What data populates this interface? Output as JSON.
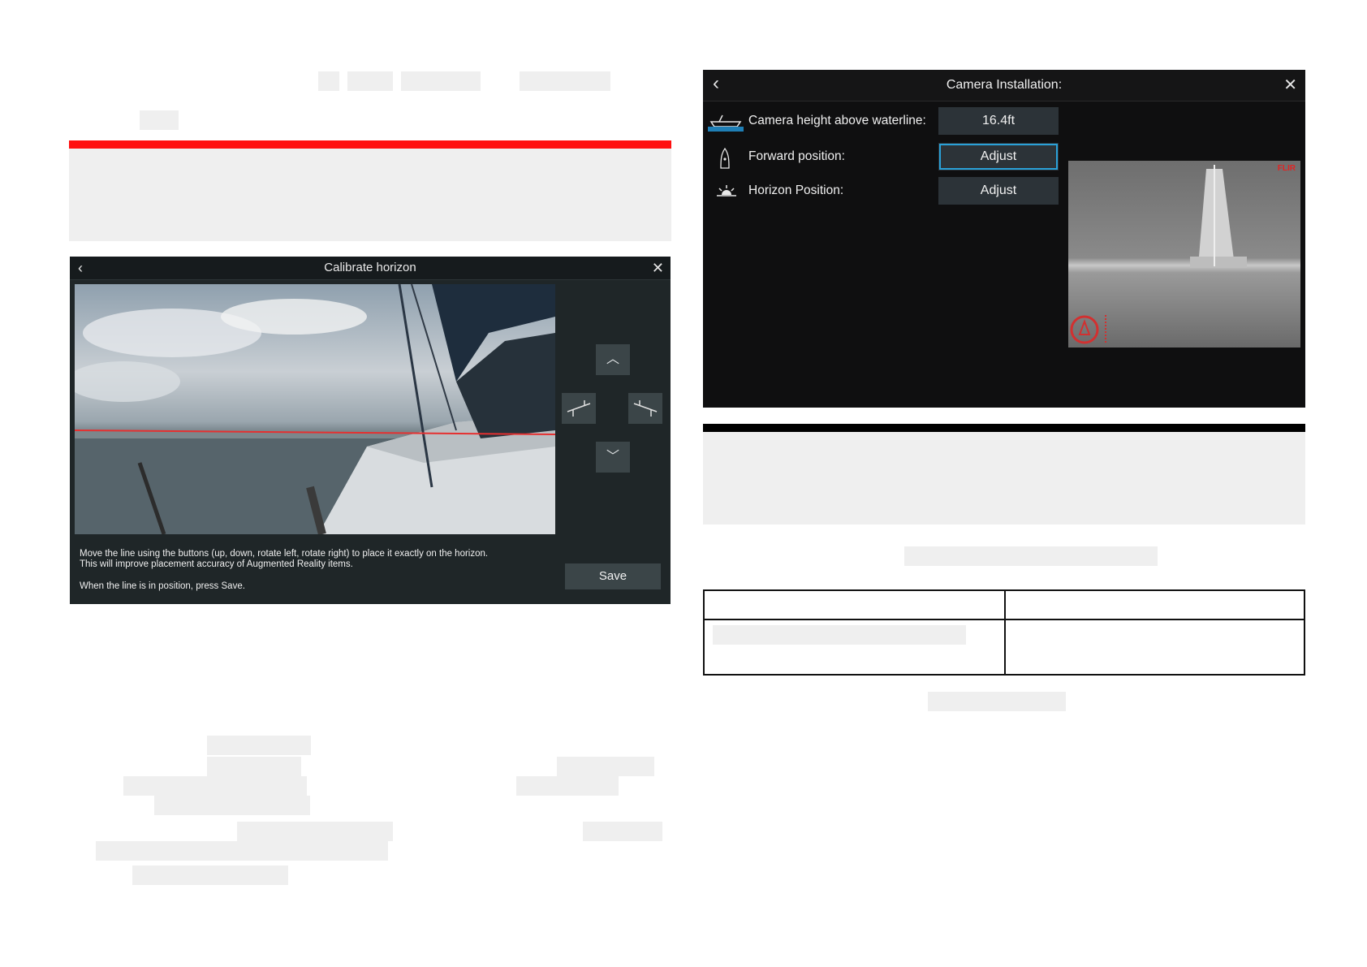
{
  "calibrate_panel": {
    "title": "Calibrate horizon",
    "controls": [
      "up",
      "rotate-left",
      "rotate-right",
      "down"
    ],
    "instruction_line1": "Move the line using the buttons (up, down, rotate left, rotate right) to place it exactly on the horizon.",
    "instruction_line2": "This will improve placement accuracy of Augmented Reality items.",
    "instruction_line3": "When the line is in position, press Save.",
    "save_label": "Save"
  },
  "camera_panel": {
    "title": "Camera Installation:",
    "rows": [
      {
        "label": "Camera height above waterline:",
        "value": "16.4ft",
        "icon": "boat-waterline-icon"
      },
      {
        "label": "Forward position:",
        "value": "Adjust",
        "icon": "bow-position-icon"
      },
      {
        "label": "Horizon Position:",
        "value": "Adjust",
        "icon": "horizon-sun-icon"
      }
    ],
    "thermal_brand": "FLIR"
  },
  "colors": {
    "accent_red_rule": "#ff1010",
    "black_rule": "#000000",
    "selected_outline": "#2aa1d8",
    "horizon_line": "#e53030"
  }
}
